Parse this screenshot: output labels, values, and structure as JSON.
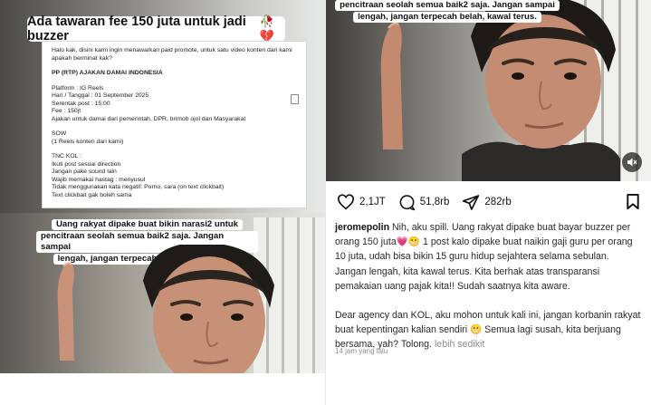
{
  "story": {
    "title": "Ada tawaran fee 150 juta untuk jadi buzzer",
    "title_emoji": "🥀💔",
    "doc_lines": [
      {
        "text": "Halo kak, disini kami ingin menawarkan paid promote, untuk satu video konten dari kami apakah berminat kak?",
        "bold": false
      },
      {
        "text": "",
        "bold": false
      },
      {
        "text": "PP (RTP) AJAKAN DAMAI INDONESIA",
        "bold": true
      },
      {
        "text": "",
        "bold": false
      },
      {
        "text": "Platform : IG Reels",
        "bold": false
      },
      {
        "text": "Hari / Tanggal : 01 September 2025",
        "bold": false
      },
      {
        "text": "Serentak post : 15:00",
        "bold": false
      },
      {
        "text": "Fee : 150jt",
        "bold": false
      },
      {
        "text": "Ajakan untuk damai dari pemerintah, DPR, brimob ojol dan Masyarakat",
        "bold": false
      },
      {
        "text": "",
        "bold": false
      },
      {
        "text": "SOW",
        "bold": false
      },
      {
        "text": "(1 Reels konten dari kami)",
        "bold": false
      },
      {
        "text": "",
        "bold": false
      },
      {
        "text": "TNC KOL :",
        "bold": false
      },
      {
        "text": "Ikuti post sesuai direction",
        "bold": false
      },
      {
        "text": "Jangan pake sound lain",
        "bold": false
      },
      {
        "text": "Wajib memakai hastag : menyusul",
        "bold": false
      },
      {
        "text": "Tidak menggunakan kata negatif: Porno, sara (on text clickbait)",
        "bold": false
      },
      {
        "text": "Text clickbait gak boleh sama",
        "bold": false
      }
    ],
    "caption_lines": [
      "Uang rakyat dipake buat bikin narasi2 untuk",
      "pencitraan seolah semua baik2 saja. Jangan sampai",
      "lengah, jangan terpecah belah, kawal terus."
    ]
  },
  "post": {
    "overlay_lines": [
      "pencitraan seolah semua baik2 saja. Jangan sampai",
      "lengah, jangan terpecah belah, kawal terus."
    ],
    "likes": "2,1JT",
    "comments": "51,8rb",
    "shares": "282rb",
    "username": "jeromepolin",
    "caption_p1": "Nih, aku spill. Uang rakyat dipake buat bayar buzzer per orang 150 juta💗😬 1 post kalo dipake buat naikin gaji guru per orang 10 juta, udah bisa bikin 15 guru hidup sejahtera selama sebulan. Jangan lengah, kita kawal terus. Kita berhak atas transparansi pemakaian uang pajak kita!! Sudah saatnya kita aware.",
    "caption_p2": "Dear agency dan KOL, aku mohon untuk kali ini, jangan korbanin rakyat buat kepentingan kalian sendiri 😬 Semua lagi susah, kita berjuang bersama, yah? Tolong.",
    "more_label": "lebih sedikit",
    "timestamp": "14 jam yang lalu"
  },
  "icons": {
    "like": "heart-icon",
    "comment": "comment-icon",
    "share": "send-icon",
    "save": "bookmark-icon",
    "sound": "speaker-muted-icon"
  },
  "colors": {
    "text": "#111111",
    "muted": "#8e8e8e",
    "emoji_heart": "#d23b5b"
  }
}
